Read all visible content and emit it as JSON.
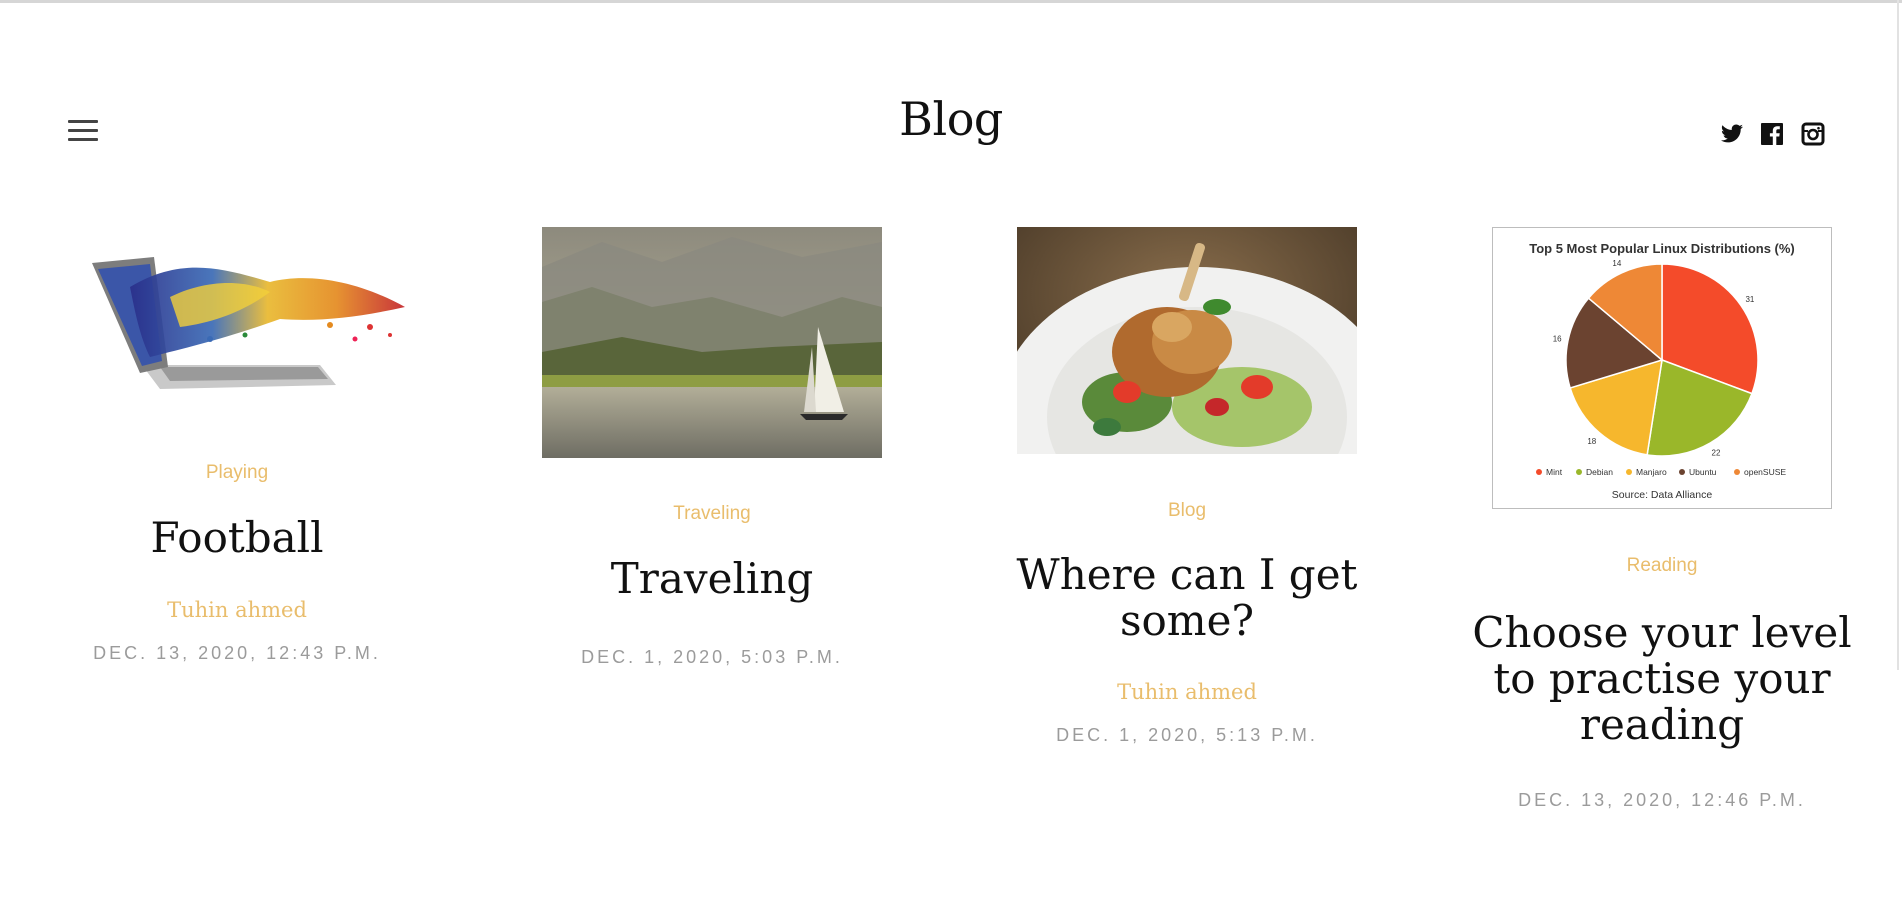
{
  "site": {
    "title": "Blog"
  },
  "nav": {
    "menu_icon": "hamburger-menu-icon"
  },
  "social": [
    {
      "name": "twitter-icon"
    },
    {
      "name": "facebook-icon"
    },
    {
      "name": "instagram-icon"
    }
  ],
  "posts": [
    {
      "category": "Playing",
      "title": "Football",
      "author": "Tuhin ahmed",
      "date": "DEC. 13, 2020, 12:43 P.M.",
      "image": "laptop-color-splash"
    },
    {
      "category": "Traveling",
      "title": "Traveling",
      "author": "",
      "date": "DEC. 1, 2020, 5:03 P.M.",
      "image": "lake-sailboat"
    },
    {
      "category": "Blog",
      "title": "Where can I get some?",
      "author": "Tuhin ahmed",
      "date": "DEC. 1, 2020, 5:13 P.M.",
      "image": "roast-chicken-salad"
    },
    {
      "category": "Reading",
      "title": "Choose your level to practise your reading",
      "author": "",
      "date": "DEC. 13, 2020, 12:46 P.M.",
      "image": "linux-distributions-pie-chart"
    }
  ],
  "chart_data": {
    "type": "pie",
    "title": "Top 5 Most Popular Linux Distributions (%)",
    "categories": [
      "Mint",
      "Debian",
      "Manjaro",
      "Ubuntu",
      "openSUSE"
    ],
    "values": [
      31,
      22,
      18,
      16,
      14
    ],
    "colors": [
      "#f44b2a",
      "#9ab72a",
      "#f6b72d",
      "#6b4330",
      "#ee8836"
    ],
    "source": "Source: Data Alliance",
    "legend": "bottom"
  }
}
